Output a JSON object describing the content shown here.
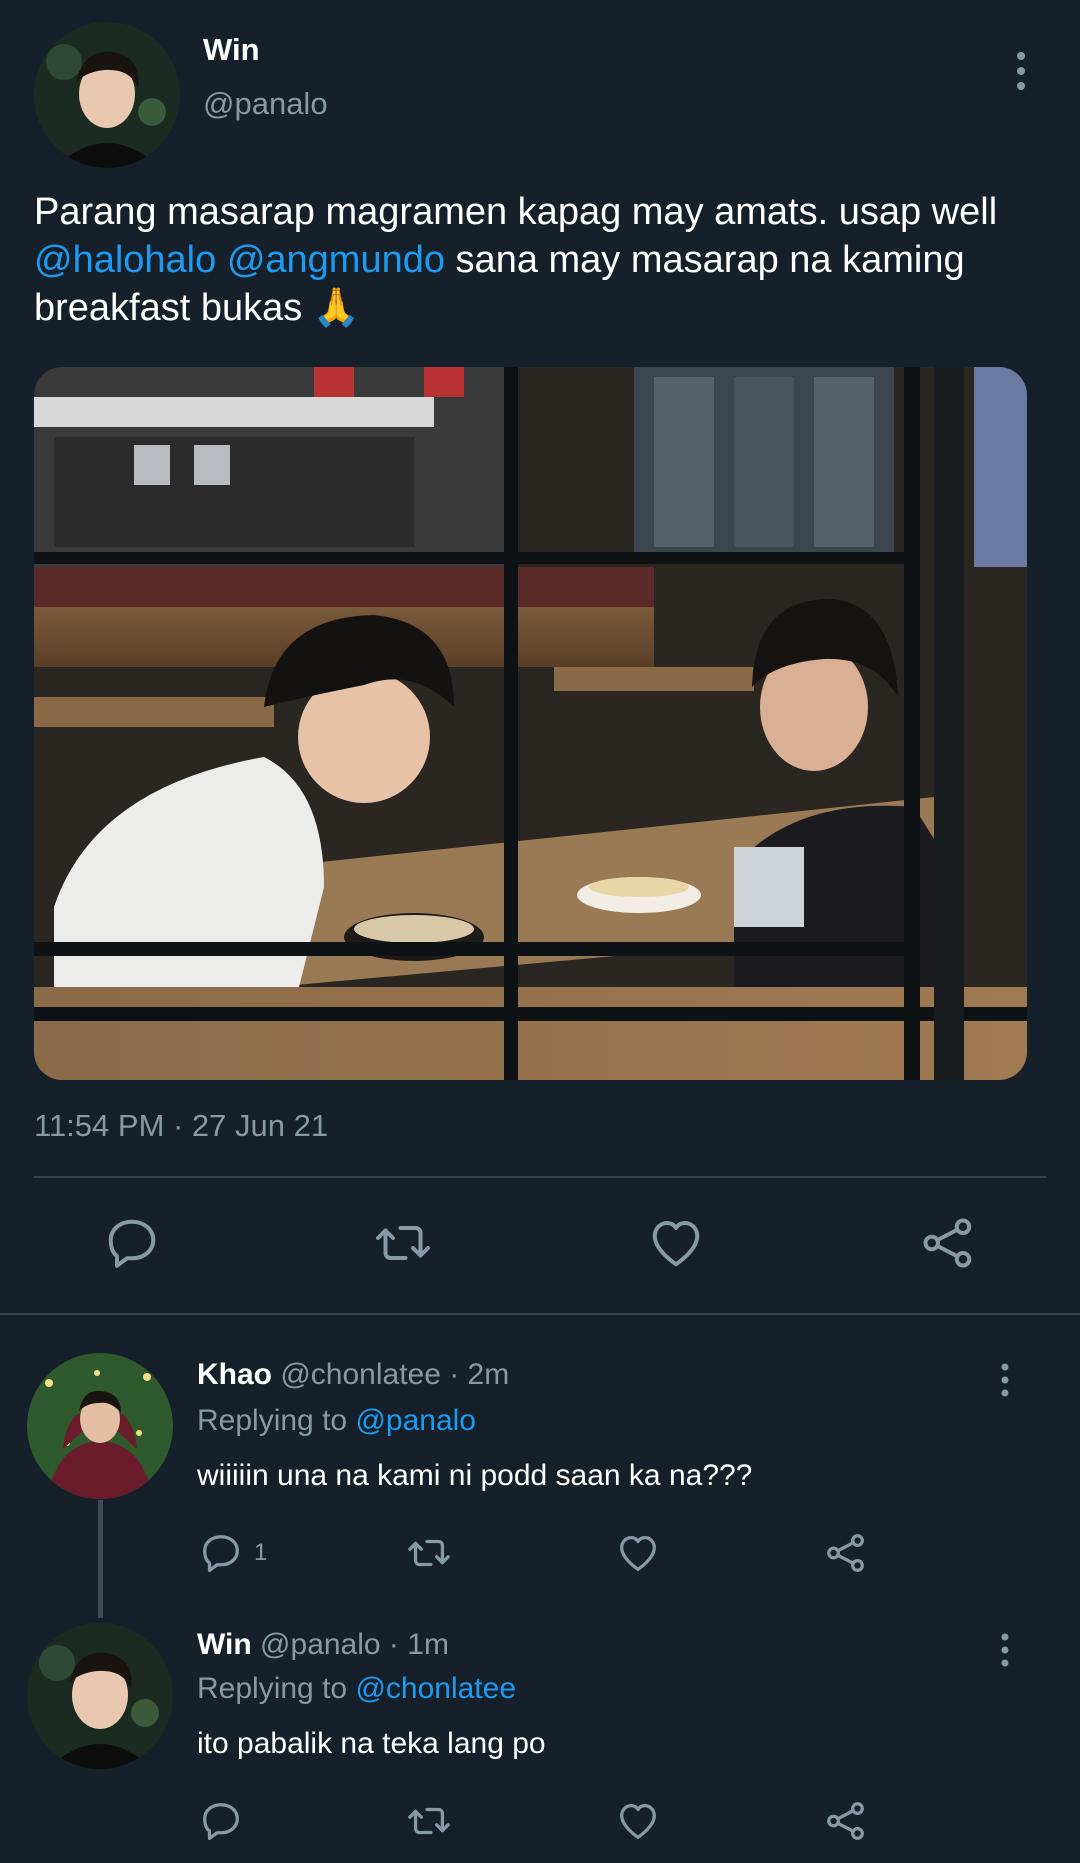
{
  "tweet": {
    "name": "Win",
    "handle": "@panalo",
    "text_1": "Parang masarap magramen kapag may amats. usap well ",
    "mention_1": "@halohalo",
    "space": " ",
    "mention_2": "@angmundo",
    "text_2": " sana may masarap na kaming breakfast bukas ",
    "emoji": "🙏",
    "timestamp": "11:54 PM · 27 Jun 21",
    "icons": [
      "reply-icon",
      "retweet-icon",
      "like-icon",
      "share-icon",
      "more-icon"
    ]
  },
  "replies": [
    {
      "name": "Khao",
      "meta": " @chonlatee · 2m",
      "replying_prefix": "Replying to ",
      "replying_to": "@panalo",
      "text": "wiiiiin una na kami ni podd saan ka na???",
      "reply_count": "1"
    },
    {
      "name": "Win",
      "meta": " @panalo · 1m",
      "replying_prefix": "Replying to ",
      "replying_to": "@chonlatee",
      "text": "ito pabalik na teka lang po"
    }
  ],
  "colors": {
    "background": "#15202b",
    "muted_text": "#8899a6",
    "link": "#1d9bf0",
    "divider": "#38444d"
  }
}
